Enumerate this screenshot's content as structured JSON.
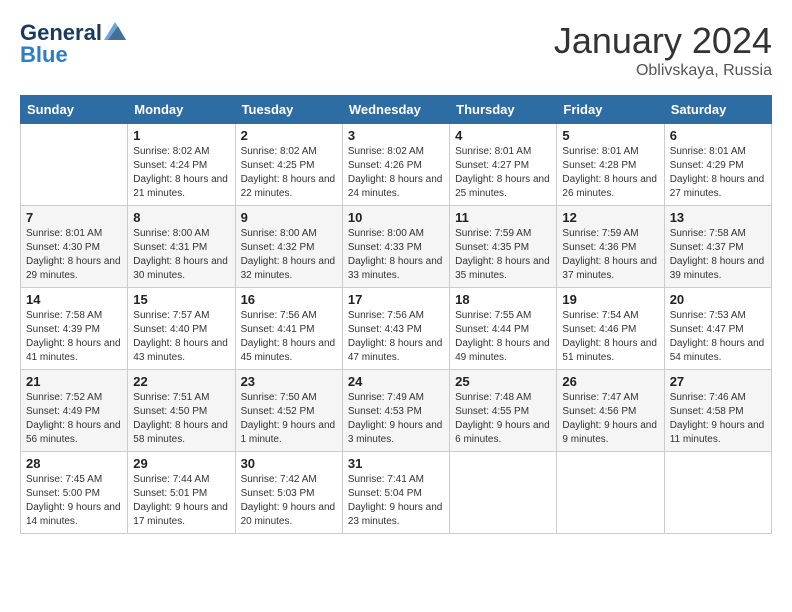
{
  "header": {
    "logo": {
      "line1": "General",
      "line2": "Blue"
    },
    "title": "January 2024",
    "location": "Oblivskaya, Russia"
  },
  "columns": [
    "Sunday",
    "Monday",
    "Tuesday",
    "Wednesday",
    "Thursday",
    "Friday",
    "Saturday"
  ],
  "weeks": [
    [
      {
        "day": "",
        "info": ""
      },
      {
        "day": "1",
        "info": "Sunrise: 8:02 AM\nSunset: 4:24 PM\nDaylight: 8 hours\nand 21 minutes."
      },
      {
        "day": "2",
        "info": "Sunrise: 8:02 AM\nSunset: 4:25 PM\nDaylight: 8 hours\nand 22 minutes."
      },
      {
        "day": "3",
        "info": "Sunrise: 8:02 AM\nSunset: 4:26 PM\nDaylight: 8 hours\nand 24 minutes."
      },
      {
        "day": "4",
        "info": "Sunrise: 8:01 AM\nSunset: 4:27 PM\nDaylight: 8 hours\nand 25 minutes."
      },
      {
        "day": "5",
        "info": "Sunrise: 8:01 AM\nSunset: 4:28 PM\nDaylight: 8 hours\nand 26 minutes."
      },
      {
        "day": "6",
        "info": "Sunrise: 8:01 AM\nSunset: 4:29 PM\nDaylight: 8 hours\nand 27 minutes."
      }
    ],
    [
      {
        "day": "7",
        "info": "Sunrise: 8:01 AM\nSunset: 4:30 PM\nDaylight: 8 hours\nand 29 minutes."
      },
      {
        "day": "8",
        "info": "Sunrise: 8:00 AM\nSunset: 4:31 PM\nDaylight: 8 hours\nand 30 minutes."
      },
      {
        "day": "9",
        "info": "Sunrise: 8:00 AM\nSunset: 4:32 PM\nDaylight: 8 hours\nand 32 minutes."
      },
      {
        "day": "10",
        "info": "Sunrise: 8:00 AM\nSunset: 4:33 PM\nDaylight: 8 hours\nand 33 minutes."
      },
      {
        "day": "11",
        "info": "Sunrise: 7:59 AM\nSunset: 4:35 PM\nDaylight: 8 hours\nand 35 minutes."
      },
      {
        "day": "12",
        "info": "Sunrise: 7:59 AM\nSunset: 4:36 PM\nDaylight: 8 hours\nand 37 minutes."
      },
      {
        "day": "13",
        "info": "Sunrise: 7:58 AM\nSunset: 4:37 PM\nDaylight: 8 hours\nand 39 minutes."
      }
    ],
    [
      {
        "day": "14",
        "info": "Sunrise: 7:58 AM\nSunset: 4:39 PM\nDaylight: 8 hours\nand 41 minutes."
      },
      {
        "day": "15",
        "info": "Sunrise: 7:57 AM\nSunset: 4:40 PM\nDaylight: 8 hours\nand 43 minutes."
      },
      {
        "day": "16",
        "info": "Sunrise: 7:56 AM\nSunset: 4:41 PM\nDaylight: 8 hours\nand 45 minutes."
      },
      {
        "day": "17",
        "info": "Sunrise: 7:56 AM\nSunset: 4:43 PM\nDaylight: 8 hours\nand 47 minutes."
      },
      {
        "day": "18",
        "info": "Sunrise: 7:55 AM\nSunset: 4:44 PM\nDaylight: 8 hours\nand 49 minutes."
      },
      {
        "day": "19",
        "info": "Sunrise: 7:54 AM\nSunset: 4:46 PM\nDaylight: 8 hours\nand 51 minutes."
      },
      {
        "day": "20",
        "info": "Sunrise: 7:53 AM\nSunset: 4:47 PM\nDaylight: 8 hours\nand 54 minutes."
      }
    ],
    [
      {
        "day": "21",
        "info": "Sunrise: 7:52 AM\nSunset: 4:49 PM\nDaylight: 8 hours\nand 56 minutes."
      },
      {
        "day": "22",
        "info": "Sunrise: 7:51 AM\nSunset: 4:50 PM\nDaylight: 8 hours\nand 58 minutes."
      },
      {
        "day": "23",
        "info": "Sunrise: 7:50 AM\nSunset: 4:52 PM\nDaylight: 9 hours\nand 1 minute."
      },
      {
        "day": "24",
        "info": "Sunrise: 7:49 AM\nSunset: 4:53 PM\nDaylight: 9 hours\nand 3 minutes."
      },
      {
        "day": "25",
        "info": "Sunrise: 7:48 AM\nSunset: 4:55 PM\nDaylight: 9 hours\nand 6 minutes."
      },
      {
        "day": "26",
        "info": "Sunrise: 7:47 AM\nSunset: 4:56 PM\nDaylight: 9 hours\nand 9 minutes."
      },
      {
        "day": "27",
        "info": "Sunrise: 7:46 AM\nSunset: 4:58 PM\nDaylight: 9 hours\nand 11 minutes."
      }
    ],
    [
      {
        "day": "28",
        "info": "Sunrise: 7:45 AM\nSunset: 5:00 PM\nDaylight: 9 hours\nand 14 minutes."
      },
      {
        "day": "29",
        "info": "Sunrise: 7:44 AM\nSunset: 5:01 PM\nDaylight: 9 hours\nand 17 minutes."
      },
      {
        "day": "30",
        "info": "Sunrise: 7:42 AM\nSunset: 5:03 PM\nDaylight: 9 hours\nand 20 minutes."
      },
      {
        "day": "31",
        "info": "Sunrise: 7:41 AM\nSunset: 5:04 PM\nDaylight: 9 hours\nand 23 minutes."
      },
      {
        "day": "",
        "info": ""
      },
      {
        "day": "",
        "info": ""
      },
      {
        "day": "",
        "info": ""
      }
    ]
  ]
}
